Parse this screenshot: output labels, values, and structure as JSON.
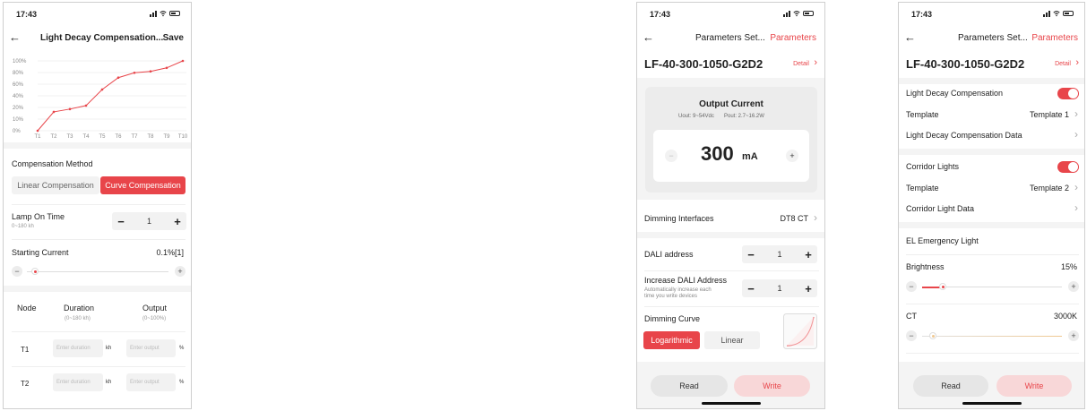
{
  "status": {
    "time": "17:43"
  },
  "phone1": {
    "nav": {
      "title": "Light Decay Compensation...",
      "save": "Save"
    },
    "chart_data": {
      "type": "line",
      "categories": [
        "T1",
        "T2",
        "T3",
        "T4",
        "T5",
        "T6",
        "T7",
        "T8",
        "T9",
        "T10"
      ],
      "values": [
        0,
        27,
        31,
        36,
        59,
        76,
        83,
        85,
        90,
        100
      ],
      "ylim": [
        0,
        100
      ],
      "yticks": [
        "100%",
        "80%",
        "60%",
        "40%",
        "20%",
        "10%",
        "0%"
      ],
      "color": "#e8454a"
    },
    "method": {
      "label": "Compensation Method",
      "linear": "Linear Compensation",
      "curve": "Curve Compensation"
    },
    "lamp": {
      "label": "Lamp On Time",
      "range": "0~180 kh",
      "value": "1"
    },
    "starting": {
      "label": "Starting Current",
      "value": "0.1%[1]"
    },
    "table": {
      "headers": {
        "node": "Node",
        "duration": "Duration",
        "duration_range": "(0~180 kh)",
        "output": "Output",
        "output_range": "(0~100%)"
      },
      "rows": [
        {
          "node": "T1",
          "duration_placeholder": "Enter duration",
          "duration_unit": "kh",
          "output_placeholder": "Enter output",
          "output_unit": "%"
        },
        {
          "node": "T2",
          "duration_placeholder": "Enter duration",
          "duration_unit": "kh",
          "output_placeholder": "Enter output",
          "output_unit": "%"
        }
      ]
    }
  },
  "phone2": {
    "nav": {
      "title": "Parameters Set...",
      "action": "Parameters"
    },
    "model": "LF-40-300-1050-G2D2",
    "detail": "Detail",
    "output": {
      "title": "Output Current",
      "uout": "Uout: 9~54Vdc",
      "pout": "Pout: 2.7~16.2W",
      "value": "300",
      "unit": "mA"
    },
    "dimming_interfaces": {
      "label": "Dimming Interfaces",
      "value": "DT8 CT"
    },
    "dali_address": {
      "label": "DALI address",
      "value": "1"
    },
    "increase": {
      "label": "Increase DALI Address",
      "sub1": "Automatically increase each",
      "sub2": "time you write devices",
      "value": "1"
    },
    "curve": {
      "label": "Dimming Curve",
      "logarithmic": "Logarithmic",
      "linear": "Linear"
    },
    "buttons": {
      "read": "Read",
      "write": "Write"
    }
  },
  "phone3": {
    "nav": {
      "title": "Parameters Set...",
      "action": "Parameters"
    },
    "model": "LF-40-300-1050-G2D2",
    "detail": "Detail",
    "ldc": {
      "label": "Light Decay Compensation",
      "template_label": "Template",
      "template_value": "Template 1",
      "data_label": "Light Decay Compensation Data"
    },
    "corridor": {
      "label": "Corridor Lights",
      "template_label": "Template",
      "template_value": "Template 2",
      "data_label": "Corridor Light Data"
    },
    "el": {
      "label": "EL Emergency Light"
    },
    "brightness": {
      "label": "Brightness",
      "value": "15%",
      "level": 0.15
    },
    "ct": {
      "label": "CT",
      "value": "3000K",
      "level": 0.08
    },
    "buttons": {
      "read": "Read",
      "write": "Write"
    }
  }
}
